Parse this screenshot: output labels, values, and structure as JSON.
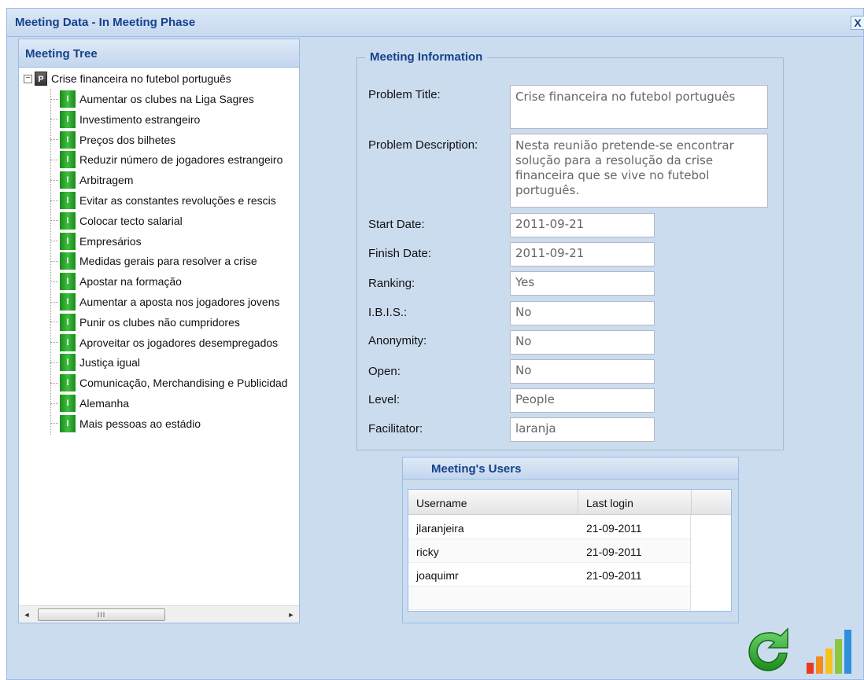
{
  "window": {
    "title": "Meeting Data - In Meeting Phase",
    "close_label": "X"
  },
  "tree": {
    "title": "Meeting Tree",
    "root": {
      "icon": "P",
      "expander": "−",
      "label": "Crise financeira no futebol português"
    },
    "items": [
      {
        "icon": "I",
        "label": "Aumentar os clubes na Liga Sagres"
      },
      {
        "icon": "I",
        "label": "Investimento estrangeiro"
      },
      {
        "icon": "I",
        "label": "Preços dos bilhetes"
      },
      {
        "icon": "I",
        "label": "Reduzir número de jogadores estrangeiro"
      },
      {
        "icon": "I",
        "label": "Arbitragem"
      },
      {
        "icon": "I",
        "label": "Evitar as constantes revoluções e rescis"
      },
      {
        "icon": "I",
        "label": "Colocar tecto salarial"
      },
      {
        "icon": "I",
        "label": "Empresários"
      },
      {
        "icon": "I",
        "label": "Medidas gerais para resolver a crise"
      },
      {
        "icon": "I",
        "label": "Apostar na formação"
      },
      {
        "icon": "I",
        "label": "Aumentar a aposta nos jogadores jovens"
      },
      {
        "icon": "I",
        "label": "Punir os clubes não cumpridores"
      },
      {
        "icon": "I",
        "label": "Aproveitar os jogadores desempregados"
      },
      {
        "icon": "I",
        "label": "Justiça igual"
      },
      {
        "icon": "I",
        "label": "Comunicação, Merchandising e Publicidad"
      },
      {
        "icon": "I",
        "label": "Alemanha"
      },
      {
        "icon": "I",
        "label": "Mais pessoas ao estádio"
      }
    ],
    "scroll": {
      "left": "◄",
      "right": "►",
      "thumb": "III"
    }
  },
  "info": {
    "legend": "Meeting Information",
    "fields": {
      "problem_title": {
        "label": "Problem Title:",
        "value": "Crise financeira no futebol português"
      },
      "problem_description": {
        "label": "Problem Description:",
        "value": "Nesta reunião pretende-se encontrar solução para a resolução da crise financeira que se vive no futebol português."
      },
      "start_date": {
        "label": "Start Date:",
        "value": "2011-09-21"
      },
      "finish_date": {
        "label": "Finish Date:",
        "value": "2011-09-21"
      },
      "ranking": {
        "label": "Ranking:",
        "value": "Yes"
      },
      "ibis": {
        "label": "I.B.I.S.:",
        "value": "No"
      },
      "anonymity": {
        "label": "Anonymity:",
        "value": "No"
      },
      "open": {
        "label": "Open:",
        "value": "No"
      },
      "level": {
        "label": "Level:",
        "value": "People"
      },
      "facilitator": {
        "label": "Facilitator:",
        "value": "laranja"
      }
    }
  },
  "users": {
    "title": "Meeting's Users",
    "columns": [
      "Username",
      "Last login"
    ],
    "rows": [
      [
        "jlaranjeira",
        "21-09-2011"
      ],
      [
        "ricky",
        "21-09-2011"
      ],
      [
        "joaquimr",
        "21-09-2011"
      ]
    ]
  },
  "icons": {
    "refresh": "refresh-icon",
    "chart": "bar-chart-icon",
    "refresh_color": "#2fa82f",
    "chart_colors": [
      "#e83a1e",
      "#f08b1c",
      "#f6c21b",
      "#8cc63e",
      "#2f8fd8"
    ]
  }
}
